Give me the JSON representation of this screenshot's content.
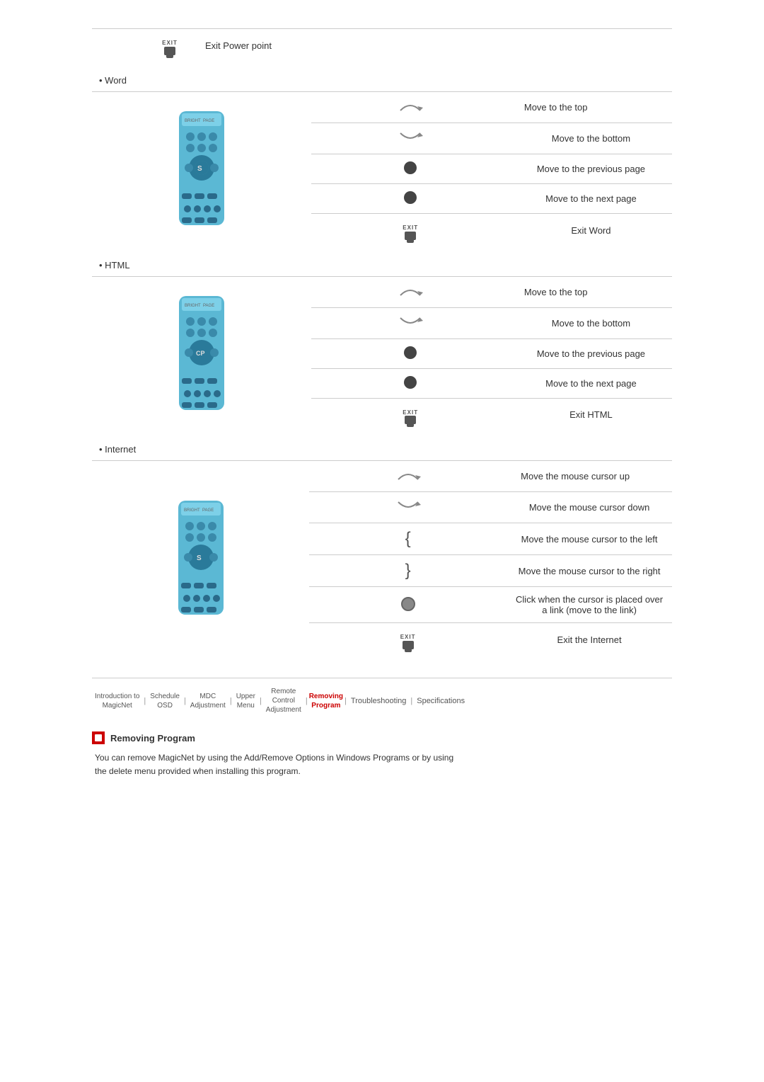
{
  "page": {
    "sections": [
      {
        "type": "section-header",
        "label": "• Word"
      },
      {
        "type": "table",
        "rows": [
          {
            "icon": "arrow-up",
            "description": "Move to the top"
          },
          {
            "icon": "arrow-down",
            "description": "Move to the bottom"
          },
          {
            "icon": "circle-dark",
            "description": "Move to the previous page"
          },
          {
            "icon": "circle-dark",
            "description": "Move to the next page"
          },
          {
            "icon": "exit",
            "description": "Exit Word"
          }
        ]
      },
      {
        "type": "section-header",
        "label": "• HTML"
      },
      {
        "type": "table",
        "rows": [
          {
            "icon": "arrow-up",
            "description": "Move to the top"
          },
          {
            "icon": "arrow-down",
            "description": "Move to the bottom"
          },
          {
            "icon": "circle-dark",
            "description": "Move to the previous page"
          },
          {
            "icon": "circle-dark",
            "description": "Move to the next page"
          },
          {
            "icon": "exit",
            "description": "Exit HTML"
          }
        ]
      },
      {
        "type": "section-header",
        "label": "• Internet"
      },
      {
        "type": "table",
        "rows": [
          {
            "icon": "arrow-up",
            "description": "Move the mouse cursor up"
          },
          {
            "icon": "arrow-down",
            "description": "Move the mouse cursor down"
          },
          {
            "icon": "bracket-left",
            "description": "Move the mouse cursor to the left"
          },
          {
            "icon": "bracket-right",
            "description": "Move the mouse cursor to the right"
          },
          {
            "icon": "circle-link",
            "description": "Click when the cursor is placed over a link (move to the link)"
          },
          {
            "icon": "exit",
            "description": "Exit the Internet"
          }
        ]
      }
    ],
    "first_row_exit": {
      "icon": "exit",
      "description": "Exit Power point"
    },
    "bottom_nav": {
      "items": [
        {
          "label": "Introduction to\nMagicNet",
          "active": false,
          "multiline": true
        },
        {
          "label": "Schedule\nOSD",
          "active": false,
          "multiline": true
        },
        {
          "label": "MDC\nAdjustment",
          "active": false,
          "multiline": true
        },
        {
          "label": "Upper\nMenu",
          "active": false,
          "multiline": true
        },
        {
          "label": "Remote\nControl\nAdjustment",
          "active": false,
          "multiline": true
        },
        {
          "label": "Removing\nProgram",
          "active": true,
          "multiline": true
        },
        {
          "label": "Troubleshooting",
          "active": false,
          "multiline": false
        },
        {
          "label": "Specifications",
          "active": false,
          "multiline": false
        }
      ]
    },
    "removing_program": {
      "title": "Removing Program",
      "body": "You can remove MagicNet by using the Add/Remove Options in Windows Programs or by using\nthe delete menu provided when installing this program."
    }
  }
}
